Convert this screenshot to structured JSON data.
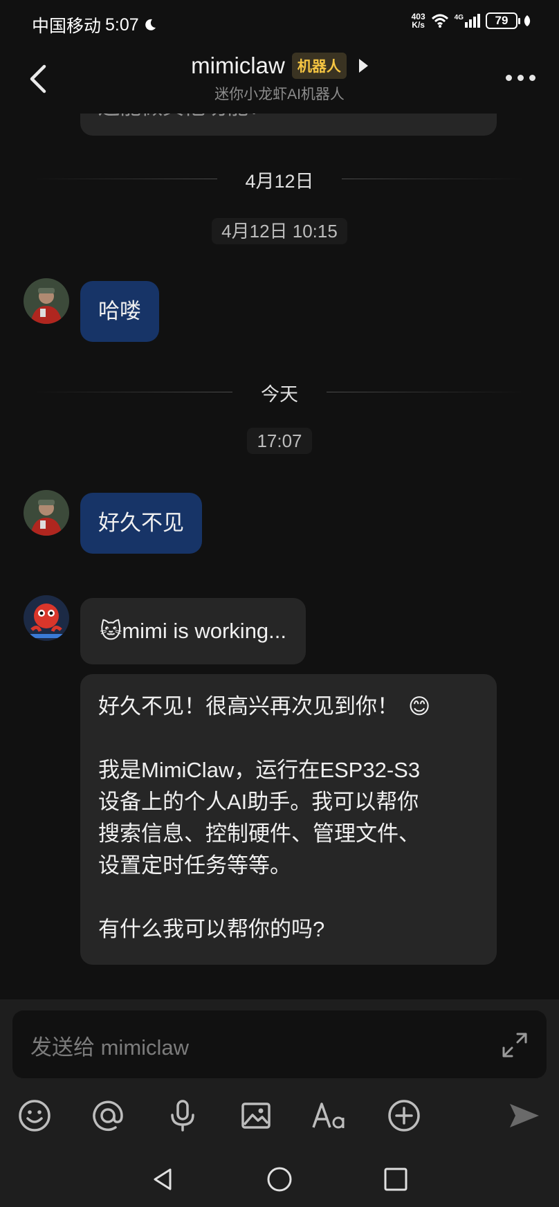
{
  "status": {
    "carrier": "中国移动",
    "time": "5:07",
    "net_speed_value": "403",
    "net_speed_unit": "K/s",
    "network_type": "4G",
    "battery": "79"
  },
  "header": {
    "title": "mimiclaw",
    "tag": "机器人",
    "subtitle": "迷你小龙虾AI机器人"
  },
  "chat": {
    "prev_bubble_partial": "还能做其他功能?",
    "divider1": "4月12日",
    "timestamp1": "4月12日 10:15",
    "msg1": "哈喽",
    "divider2": "今天",
    "timestamp2": "17:07",
    "msg2": "好久不见",
    "bot_status": "🐱mimi is working...",
    "bot_reply": {
      "line1": "好久不见！很高兴再次见到你！",
      "emoji": "😊",
      "para2_l1": "我是MimiClaw，运行在ESP32-S3",
      "para2_l2": "设备上的个人AI助手。我可以帮你",
      "para2_l3": "搜索信息、控制硬件、管理文件、",
      "para2_l4": "设置定时任务等等。",
      "para3": "有什么我可以帮你的吗?"
    }
  },
  "composer": {
    "placeholder": "发送给 mimiclaw"
  },
  "colors": {
    "user_bubble": "#173467",
    "bot_bubble": "#262626",
    "tag_text": "#f5c542"
  }
}
